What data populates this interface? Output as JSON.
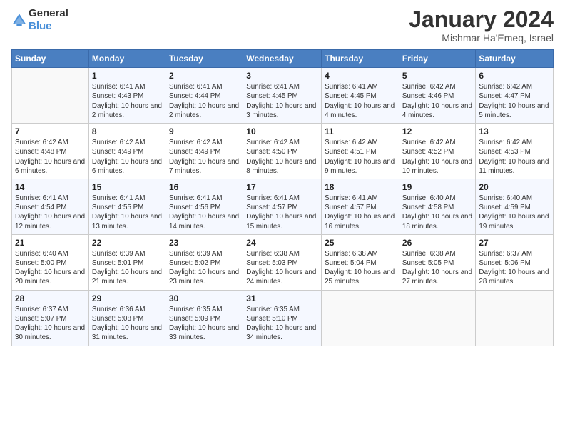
{
  "header": {
    "logo_general": "General",
    "logo_blue": "Blue",
    "title": "January 2024",
    "subtitle": "Mishmar Ha'Emeq, Israel"
  },
  "columns": [
    "Sunday",
    "Monday",
    "Tuesday",
    "Wednesday",
    "Thursday",
    "Friday",
    "Saturday"
  ],
  "weeks": [
    [
      {
        "day": "",
        "sunrise": "",
        "sunset": "",
        "daylight": ""
      },
      {
        "day": "1",
        "sunrise": "Sunrise: 6:41 AM",
        "sunset": "Sunset: 4:43 PM",
        "daylight": "Daylight: 10 hours and 2 minutes."
      },
      {
        "day": "2",
        "sunrise": "Sunrise: 6:41 AM",
        "sunset": "Sunset: 4:44 PM",
        "daylight": "Daylight: 10 hours and 2 minutes."
      },
      {
        "day": "3",
        "sunrise": "Sunrise: 6:41 AM",
        "sunset": "Sunset: 4:45 PM",
        "daylight": "Daylight: 10 hours and 3 minutes."
      },
      {
        "day": "4",
        "sunrise": "Sunrise: 6:41 AM",
        "sunset": "Sunset: 4:45 PM",
        "daylight": "Daylight: 10 hours and 4 minutes."
      },
      {
        "day": "5",
        "sunrise": "Sunrise: 6:42 AM",
        "sunset": "Sunset: 4:46 PM",
        "daylight": "Daylight: 10 hours and 4 minutes."
      },
      {
        "day": "6",
        "sunrise": "Sunrise: 6:42 AM",
        "sunset": "Sunset: 4:47 PM",
        "daylight": "Daylight: 10 hours and 5 minutes."
      }
    ],
    [
      {
        "day": "7",
        "sunrise": "Sunrise: 6:42 AM",
        "sunset": "Sunset: 4:48 PM",
        "daylight": "Daylight: 10 hours and 6 minutes."
      },
      {
        "day": "8",
        "sunrise": "Sunrise: 6:42 AM",
        "sunset": "Sunset: 4:49 PM",
        "daylight": "Daylight: 10 hours and 6 minutes."
      },
      {
        "day": "9",
        "sunrise": "Sunrise: 6:42 AM",
        "sunset": "Sunset: 4:49 PM",
        "daylight": "Daylight: 10 hours and 7 minutes."
      },
      {
        "day": "10",
        "sunrise": "Sunrise: 6:42 AM",
        "sunset": "Sunset: 4:50 PM",
        "daylight": "Daylight: 10 hours and 8 minutes."
      },
      {
        "day": "11",
        "sunrise": "Sunrise: 6:42 AM",
        "sunset": "Sunset: 4:51 PM",
        "daylight": "Daylight: 10 hours and 9 minutes."
      },
      {
        "day": "12",
        "sunrise": "Sunrise: 6:42 AM",
        "sunset": "Sunset: 4:52 PM",
        "daylight": "Daylight: 10 hours and 10 minutes."
      },
      {
        "day": "13",
        "sunrise": "Sunrise: 6:42 AM",
        "sunset": "Sunset: 4:53 PM",
        "daylight": "Daylight: 10 hours and 11 minutes."
      }
    ],
    [
      {
        "day": "14",
        "sunrise": "Sunrise: 6:41 AM",
        "sunset": "Sunset: 4:54 PM",
        "daylight": "Daylight: 10 hours and 12 minutes."
      },
      {
        "day": "15",
        "sunrise": "Sunrise: 6:41 AM",
        "sunset": "Sunset: 4:55 PM",
        "daylight": "Daylight: 10 hours and 13 minutes."
      },
      {
        "day": "16",
        "sunrise": "Sunrise: 6:41 AM",
        "sunset": "Sunset: 4:56 PM",
        "daylight": "Daylight: 10 hours and 14 minutes."
      },
      {
        "day": "17",
        "sunrise": "Sunrise: 6:41 AM",
        "sunset": "Sunset: 4:57 PM",
        "daylight": "Daylight: 10 hours and 15 minutes."
      },
      {
        "day": "18",
        "sunrise": "Sunrise: 6:41 AM",
        "sunset": "Sunset: 4:57 PM",
        "daylight": "Daylight: 10 hours and 16 minutes."
      },
      {
        "day": "19",
        "sunrise": "Sunrise: 6:40 AM",
        "sunset": "Sunset: 4:58 PM",
        "daylight": "Daylight: 10 hours and 18 minutes."
      },
      {
        "day": "20",
        "sunrise": "Sunrise: 6:40 AM",
        "sunset": "Sunset: 4:59 PM",
        "daylight": "Daylight: 10 hours and 19 minutes."
      }
    ],
    [
      {
        "day": "21",
        "sunrise": "Sunrise: 6:40 AM",
        "sunset": "Sunset: 5:00 PM",
        "daylight": "Daylight: 10 hours and 20 minutes."
      },
      {
        "day": "22",
        "sunrise": "Sunrise: 6:39 AM",
        "sunset": "Sunset: 5:01 PM",
        "daylight": "Daylight: 10 hours and 21 minutes."
      },
      {
        "day": "23",
        "sunrise": "Sunrise: 6:39 AM",
        "sunset": "Sunset: 5:02 PM",
        "daylight": "Daylight: 10 hours and 23 minutes."
      },
      {
        "day": "24",
        "sunrise": "Sunrise: 6:38 AM",
        "sunset": "Sunset: 5:03 PM",
        "daylight": "Daylight: 10 hours and 24 minutes."
      },
      {
        "day": "25",
        "sunrise": "Sunrise: 6:38 AM",
        "sunset": "Sunset: 5:04 PM",
        "daylight": "Daylight: 10 hours and 25 minutes."
      },
      {
        "day": "26",
        "sunrise": "Sunrise: 6:38 AM",
        "sunset": "Sunset: 5:05 PM",
        "daylight": "Daylight: 10 hours and 27 minutes."
      },
      {
        "day": "27",
        "sunrise": "Sunrise: 6:37 AM",
        "sunset": "Sunset: 5:06 PM",
        "daylight": "Daylight: 10 hours and 28 minutes."
      }
    ],
    [
      {
        "day": "28",
        "sunrise": "Sunrise: 6:37 AM",
        "sunset": "Sunset: 5:07 PM",
        "daylight": "Daylight: 10 hours and 30 minutes."
      },
      {
        "day": "29",
        "sunrise": "Sunrise: 6:36 AM",
        "sunset": "Sunset: 5:08 PM",
        "daylight": "Daylight: 10 hours and 31 minutes."
      },
      {
        "day": "30",
        "sunrise": "Sunrise: 6:35 AM",
        "sunset": "Sunset: 5:09 PM",
        "daylight": "Daylight: 10 hours and 33 minutes."
      },
      {
        "day": "31",
        "sunrise": "Sunrise: 6:35 AM",
        "sunset": "Sunset: 5:10 PM",
        "daylight": "Daylight: 10 hours and 34 minutes."
      },
      {
        "day": "",
        "sunrise": "",
        "sunset": "",
        "daylight": ""
      },
      {
        "day": "",
        "sunrise": "",
        "sunset": "",
        "daylight": ""
      },
      {
        "day": "",
        "sunrise": "",
        "sunset": "",
        "daylight": ""
      }
    ]
  ]
}
